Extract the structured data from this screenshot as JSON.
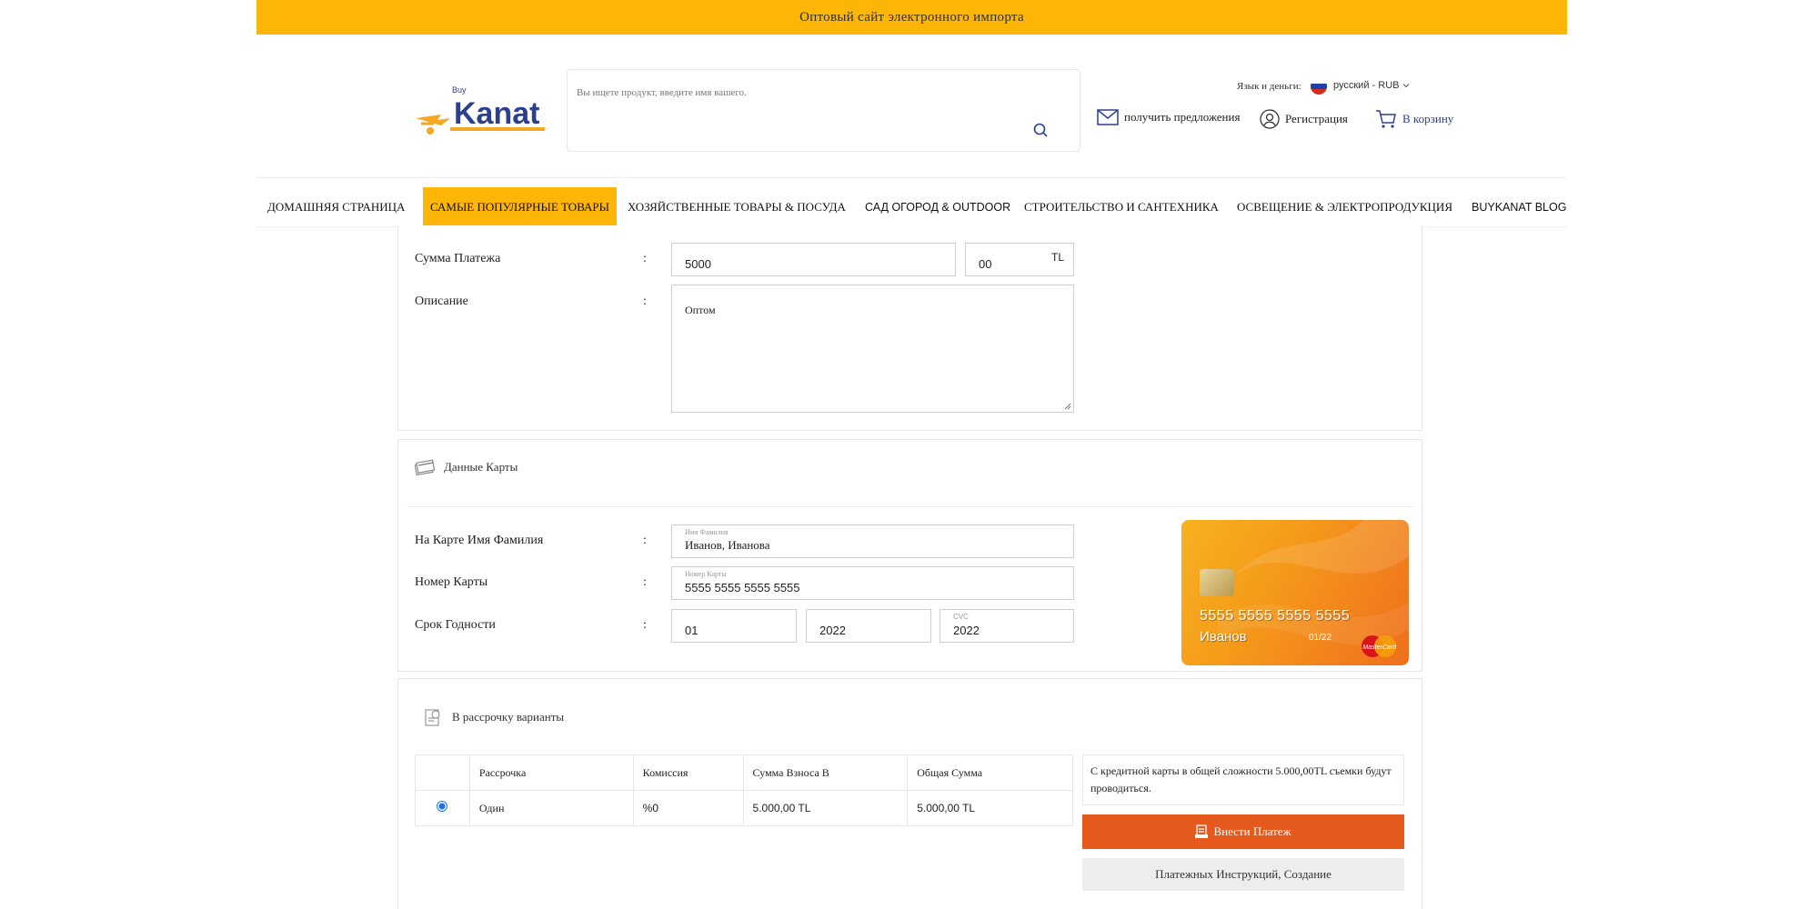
{
  "banner": {
    "text": "Оптовый сайт электронного импорта"
  },
  "header": {
    "logo_text": "Kanat",
    "search_placeholder": "Вы ищете продукт, введите имя вашего.",
    "language_label": "Язык и деньги:",
    "language_value": "русский - RUB",
    "offers_link": "получить предложения",
    "register_link": "Регистрация",
    "cart_link": "В корзину"
  },
  "nav": {
    "items": [
      "ДОМАШНЯЯ СТРАНИЦА",
      "САМЫЕ ПОПУЛЯРНЫЕ ТОВАРЫ",
      "ХОЗЯЙСТВЕННЫЕ ТОВАРЫ & ПОСУДА",
      "САД ОГОРОД & OUTDOOR",
      "СТРОИТЕЛЬСТВО И САНТЕХНИКА",
      "ОСВЕЩЕНИЕ & ЭЛЕКТРОПРОДУКЦИЯ",
      "BUYKANAT BLOG"
    ]
  },
  "payment": {
    "amount_label": "Сумма Платежа",
    "colon": ":",
    "amount_main": "5000",
    "amount_cents": "00",
    "currency": "TL",
    "description_label": "Описание",
    "description_value": "Оптом"
  },
  "card": {
    "section_title": "Данные Карты",
    "holder_label": "На Карте Имя Фамилия",
    "holder_hint": "Имя Фамилия",
    "holder_value": "Иванов, Иванова",
    "number_label": "Номер Карты",
    "number_hint": "Номер Карты",
    "number_value": "5555 5555 5555 5555",
    "expiry_label": "Срок Годности",
    "expiry_month": "01",
    "expiry_year": "2022",
    "cvc_hint": "CVC",
    "cvc_value": "2022",
    "preview_number": "5555 5555 5555 5555",
    "preview_name": "Иванов",
    "preview_expiry": "01/22",
    "preview_brand": "MasterCard"
  },
  "installments": {
    "section_title": "В рассрочку варианты",
    "columns": [
      "",
      "Рассрочка",
      "Комиссия",
      "Сумма Взноса В",
      "Общая Сумма"
    ],
    "rows": [
      {
        "name": "Один",
        "commission": "%0",
        "installment": "5.000,00 TL",
        "total": "5.000,00 TL",
        "selected": true
      }
    ],
    "info": "С кредитной карты в общей сложности 5.000,00TL съемки будут проводиться.",
    "pay_button": "Внести Платеж",
    "instructions_button": "Платежных Инструкций, Создание"
  },
  "colors": {
    "accent": "#fdb507",
    "pay": "#e6591d",
    "cart": "#2b3f8f"
  }
}
